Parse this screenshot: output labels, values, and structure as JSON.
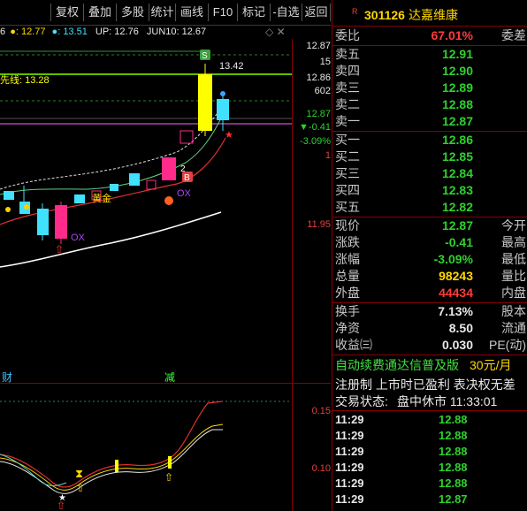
{
  "toolbar": {
    "buttons": [
      "复权",
      "叠加",
      "多股",
      "统计",
      "画线",
      "F10",
      "标记",
      "-自选",
      "返回"
    ]
  },
  "info": {
    "prefix": "6",
    "v1": ": 12.77",
    "v2": ": 13.51",
    "up_label": "UP: 12.76",
    "jun_label": "JUN10: 12.67"
  },
  "chart": {
    "price_axis": {
      "p1": "12.87",
      "p2": "15",
      "p3": "12.86",
      "p4": "602",
      "p5": "12.87",
      "p6": "▼-0.41",
      "p7": "-3.09%",
      "p8": "1",
      "p9": "11.95"
    },
    "labels": {
      "high": "13.42",
      "line_label": "先线: 13.28",
      "s_marker": "S",
      "b_marker": "B",
      "ox1": "OX",
      "ox2": "OX",
      "lv": "2",
      "huang": "黄金"
    },
    "lower_axis": {
      "a1": "0.15",
      "a2": "0.10"
    },
    "divider_labels": {
      "left": "财",
      "mid": "减"
    },
    "colors": {
      "up": "#ff2a8a",
      "down": "#40e0ff",
      "yellow": "#ffff00",
      "ma_white": "#ffffff",
      "ma_red": "#e03030"
    }
  },
  "panel": {
    "code": "301126",
    "name": "达嘉维康",
    "r_mark": "R",
    "wei": {
      "label": "委比",
      "value": "67.01%",
      "right": "委差"
    },
    "asks": [
      {
        "label": "卖五",
        "price": "12.91"
      },
      {
        "label": "卖四",
        "price": "12.90"
      },
      {
        "label": "卖三",
        "price": "12.89"
      },
      {
        "label": "卖二",
        "price": "12.88"
      },
      {
        "label": "卖一",
        "price": "12.87"
      }
    ],
    "bids": [
      {
        "label": "买一",
        "price": "12.86"
      },
      {
        "label": "买二",
        "price": "12.85"
      },
      {
        "label": "买三",
        "price": "12.84"
      },
      {
        "label": "买四",
        "price": "12.83"
      },
      {
        "label": "买五",
        "price": "12.82"
      }
    ],
    "stats": [
      {
        "label": "现价",
        "value": "12.87",
        "right": "今开",
        "color": "g"
      },
      {
        "label": "涨跌",
        "value": "-0.41",
        "right": "最高",
        "color": "g"
      },
      {
        "label": "涨幅",
        "value": "-3.09%",
        "right": "最低",
        "color": "g"
      },
      {
        "label": "总量",
        "value": "98243",
        "right": "量比",
        "color": "y"
      },
      {
        "label": "外盘",
        "value": "44434",
        "right": "内盘",
        "color": "r"
      }
    ],
    "stats2": [
      {
        "label": "换手",
        "value": "7.13%",
        "right": "股本",
        "color": "w"
      },
      {
        "label": "净资",
        "value": "8.50",
        "right": "流通",
        "color": "w"
      },
      {
        "label": "收益㈢",
        "value": "0.030",
        "right": "PE(动)",
        "color": "w"
      }
    ],
    "promo": {
      "text": "自动续费通达信普及版",
      "price": "30元/月"
    },
    "notice": "注册制 上市时已盈利 表决权无差",
    "trade_status": {
      "label": "交易状态:",
      "value": "盘中休市 11:33:01"
    },
    "ticks": [
      {
        "time": "11:29",
        "price": "12.88"
      },
      {
        "time": "11:29",
        "price": "12.88"
      },
      {
        "time": "11:29",
        "price": "12.88"
      },
      {
        "time": "11:29",
        "price": "12.88"
      },
      {
        "time": "11:29",
        "price": "12.88"
      },
      {
        "time": "11:29",
        "price": "12.87"
      },
      {
        "time": "11:29",
        "price": "12.87"
      }
    ]
  }
}
